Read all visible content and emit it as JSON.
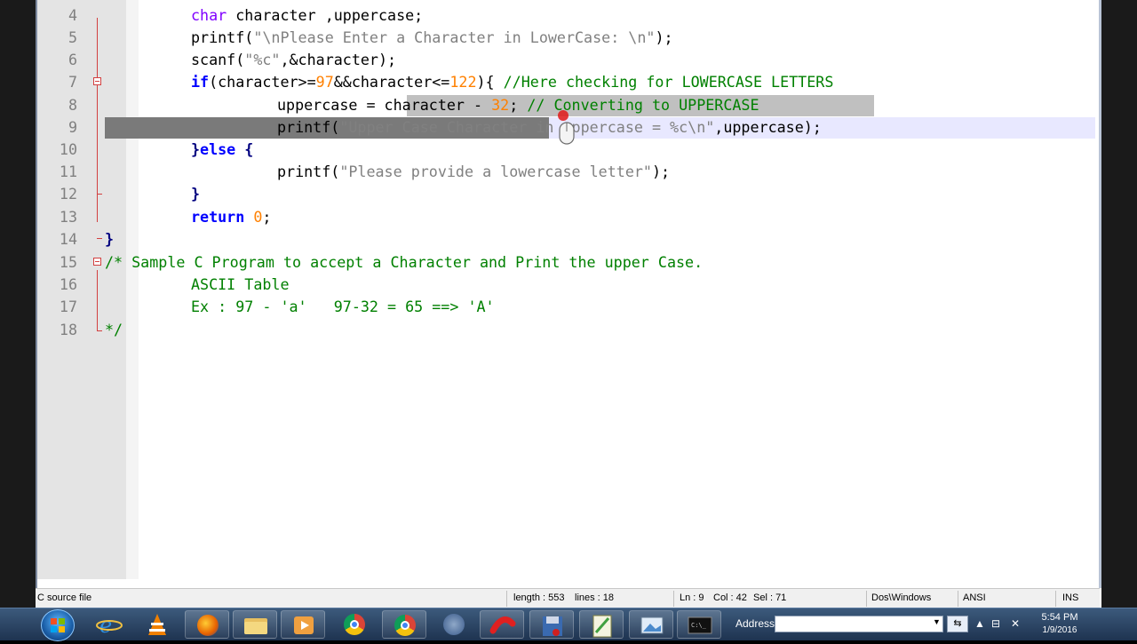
{
  "editor": {
    "lines": [
      {
        "num": "4"
      },
      {
        "num": "5"
      },
      {
        "num": "6"
      },
      {
        "num": "7"
      },
      {
        "num": "8"
      },
      {
        "num": "9"
      },
      {
        "num": "10"
      },
      {
        "num": "11"
      },
      {
        "num": "12"
      },
      {
        "num": "13"
      },
      {
        "num": "14"
      },
      {
        "num": "15"
      },
      {
        "num": "16"
      },
      {
        "num": "17"
      },
      {
        "num": "18"
      }
    ],
    "code": {
      "l4_type": "char",
      "l4_rest": " character ,uppercase;",
      "l5_fn": "printf(",
      "l5_str": "\"\\nPlease Enter a Character in LowerCase: \\n\"",
      "l5_end": ");",
      "l6_fn": "scanf(",
      "l6_str": "\"%c\"",
      "l6_end": ",&character);",
      "l7_kw": "if",
      "l7_a": "(character>=",
      "l7_n1": "97",
      "l7_b": "&&character<=",
      "l7_n2": "122",
      "l7_c": "){ ",
      "l7_cmt": "//Here checking for LOWERCASE LETTERS",
      "l8_a": "uppercase = character - ",
      "l8_n": "32",
      "l8_b": "; ",
      "l8_cmt": "// Converting to UPPERCASE",
      "l9_fn": "printf(",
      "l9_str": "\"Upper Case Character in uppercase = %c\\n\"",
      "l9_end": ",uppercase);",
      "l10_a": "}",
      "l10_kw": "else",
      "l10_b": " {",
      "l11_fn": "printf(",
      "l11_str": "\"Please provide a lowercase letter\"",
      "l11_end": ");",
      "l12": "}",
      "l13_kw": "return",
      "l13_n": " 0",
      "l13_end": ";",
      "l14": "}",
      "l15": "/* Sample C Program to accept a Character and Print the upper Case.",
      "l16": "ASCII Table",
      "l17": "Ex : 97 - 'a'   97-32 = 65 ==> 'A'",
      "l18": "*/"
    }
  },
  "statusbar": {
    "file_type": "C source file",
    "length": "length : 553",
    "lines": "lines : 18",
    "ln": "Ln : 9",
    "col": "Col : 42",
    "sel": "Sel : 71",
    "eol": "Dos\\Windows",
    "encoding": "ANSI",
    "mode": "INS"
  },
  "taskbar": {
    "address_label": "Address",
    "address_value": "",
    "time": "5:54 PM",
    "date": "1/9/2016",
    "apps": [
      "start-orb",
      "ie-icon",
      "vlc-icon",
      "firefox-icon",
      "file-explorer-icon",
      "media-icon",
      "chrome-icon",
      "chrome-icon",
      "chrome-canary-icon",
      "magnet-icon",
      "floppy-icon",
      "notepad-plus-plus-icon",
      "picture-icon",
      "cmd-icon"
    ]
  },
  "colors": {
    "keyword": "#0000ff",
    "type": "#8000ff",
    "string": "#808080",
    "number": "#ff8000",
    "comment": "#008000",
    "fold_marker": "#d24040"
  }
}
